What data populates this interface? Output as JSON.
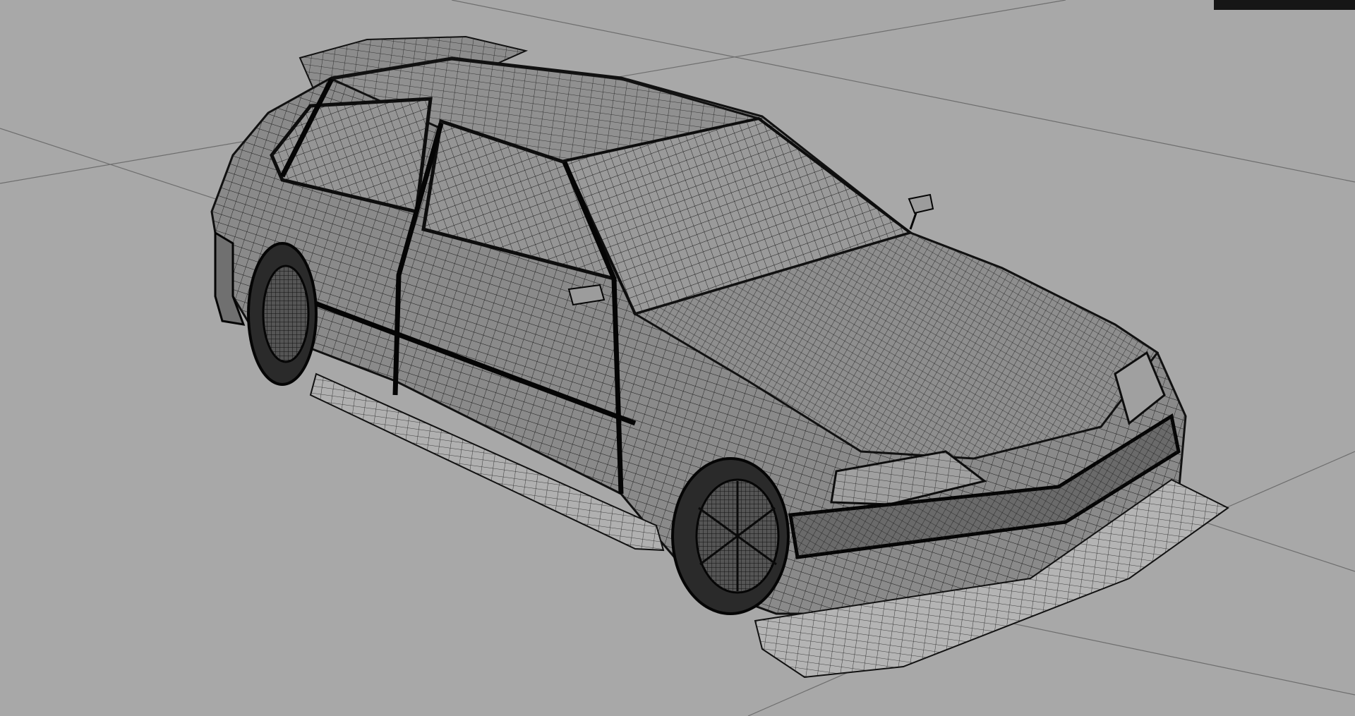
{
  "viewport": {
    "background_color": "#a8a8a8",
    "grid_line_color": "#6e6e6e",
    "wire_color": "#1a1a1a",
    "body_fill_color": "#8a8a8a",
    "glass_fill_color": "#9a9a9a",
    "tire_color": "#2a2a2a",
    "splitter_color": "#b4b4b4"
  },
  "model": {
    "shading_mode": "wireframe-on-shaded",
    "subject": "hatchback-car-mesh"
  }
}
